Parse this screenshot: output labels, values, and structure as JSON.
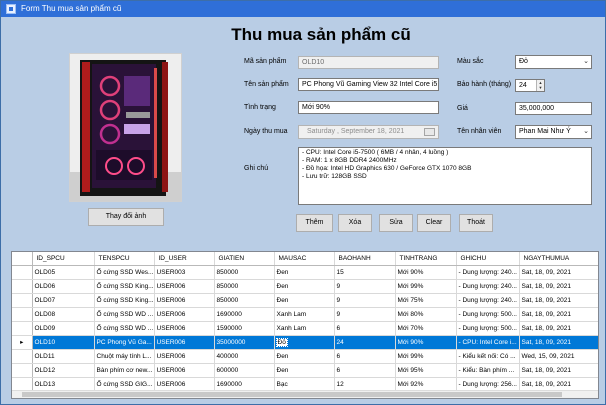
{
  "window": {
    "title": "Form Thu mua sản phẩm cũ"
  },
  "heading": "Thu mua sản phẩm cũ",
  "photo": {
    "button_label": "Thay đổi ảnh"
  },
  "fields": {
    "ma_sp": {
      "label": "Mã sản phẩm",
      "value": "OLD10"
    },
    "ten_sp": {
      "label": "Tên sản phẩm",
      "value": "PC Phong Vũ Gaming View 32 Intel Core i5"
    },
    "tinh_trang": {
      "label": "Tình trạng",
      "value": "Mới 90%"
    },
    "ngay_mua": {
      "label": "Ngày thu mua",
      "value": "Saturday  , September 18, 2021"
    },
    "ghi_chu": {
      "label": "Ghi chú",
      "lines": [
        "- CPU: Intel Core i5-7500 ( 6MB / 4 nhân, 4 luồng )",
        "- RAM: 1 x 8GB DDR4 2400MHz",
        "- Đồ họa: Intel HD Graphics 630 / GeForce GTX 1070 8GB",
        "- Lưu trữ: 128GB SSD"
      ]
    },
    "mau_sac": {
      "label": "Màu sắc",
      "value": "Đỏ"
    },
    "bao_hanh": {
      "label": "Bảo hành (tháng)",
      "value": "24"
    },
    "gia": {
      "label": "Giá",
      "value": "35,000,000"
    },
    "nhan_vien": {
      "label": "Tên nhân viên",
      "value": "Phan Mai Như Ý"
    }
  },
  "actions": {
    "add": "Thêm",
    "delete": "Xóa",
    "edit": "Sửa",
    "clear": "Clear",
    "exit": "Thoát"
  },
  "grid": {
    "columns": [
      "ID_SPCU",
      "TENSPCU",
      "ID_USER",
      "GIATIEN",
      "MAUSAC",
      "BAOHANH",
      "TINHTRANG",
      "GHICHU",
      "NGAYTHUMUA"
    ],
    "selected_row": 5,
    "row_indicator": "▸",
    "rows": [
      [
        "OLD05",
        "Ổ cứng SSD Wes...",
        "USER003",
        "850000",
        "Đen",
        "15",
        "Mới 90%",
        "- Dung lượng: 240...",
        "Sat, 18, 09, 2021"
      ],
      [
        "OLD06",
        "Ổ cứng SSD King...",
        "USER006",
        "850000",
        "Đen",
        "9",
        "Mới 99%",
        "- Dung lượng: 240...",
        "Sat, 18, 09, 2021"
      ],
      [
        "OLD07",
        "Ổ cứng SSD King...",
        "USER006",
        "850000",
        "Đen",
        "9",
        "Mới 75%",
        "- Dung lượng: 240...",
        "Sat, 18, 09, 2021"
      ],
      [
        "OLD08",
        "Ổ cứng SSD WD ...",
        "USER006",
        "1690000",
        "Xanh Lam",
        "9",
        "Mới 80%",
        "- Dung lượng: 500...",
        "Sat, 18, 09, 2021"
      ],
      [
        "OLD09",
        "Ổ cứng SSD WD ...",
        "USER006",
        "1590000",
        "Xanh Lam",
        "6",
        "Mới 70%",
        "- Dung lượng: 500...",
        "Sat, 18, 09, 2021"
      ],
      [
        "OLD10",
        "PC Phong Vũ Ga...",
        "USER006",
        "35000000",
        "Đỏ",
        "24",
        "Mới 90%",
        "- CPU: Intel Core i...",
        "Sat, 18, 09, 2021"
      ],
      [
        "OLD11",
        "Chuột máy tính L...",
        "USER006",
        "400000",
        "Đen",
        "6",
        "Mới 99%",
        "- Kiểu kết nối: Có ...",
        "Wed, 15, 09, 2021"
      ],
      [
        "OLD12",
        "Bàn phím cơ new...",
        "USER006",
        "600000",
        "Đen",
        "6",
        "Mới 95%",
        "- Kiểu: Bàn phím ...",
        "Sat, 18, 09, 2021"
      ],
      [
        "OLD13",
        "Ổ cứng SSD GIG...",
        "USER006",
        "1690000",
        "Bạc",
        "12",
        "Mới 92%",
        "- Dung lượng: 256...",
        "Sat, 18, 09, 2021"
      ]
    ]
  },
  "icons": {
    "dropdown": "chevron-down-icon",
    "calendar": "calendar-icon",
    "spinner": "up-down-arrows-icon"
  }
}
